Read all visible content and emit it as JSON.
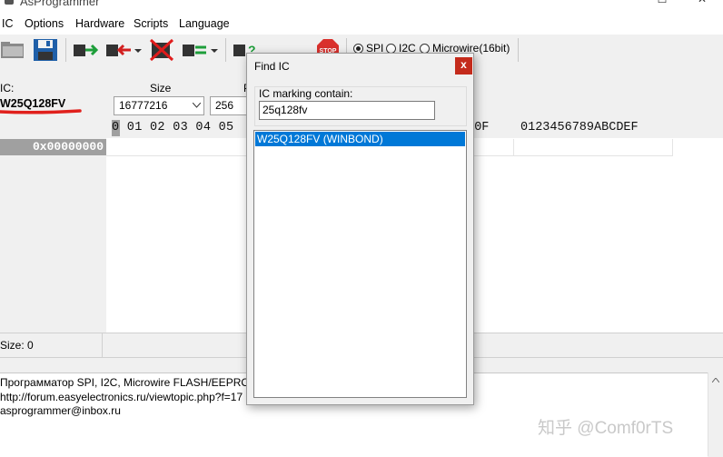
{
  "window": {
    "title": "AsProgrammer",
    "controls": [
      "─",
      "☐",
      "✕"
    ]
  },
  "menu": [
    "IC",
    "Options",
    "Hardware",
    "Scripts",
    "Language"
  ],
  "interfaces": {
    "selected": "SPI",
    "options": [
      "SPI",
      "I2C",
      "Microwire(16bit)"
    ]
  },
  "toolbar": {
    "stop_label": "STOP"
  },
  "ic_panel": {
    "label": "IC:",
    "ic_name": "W25Q128FV",
    "size_label": "Size",
    "size_value": "16777216",
    "page_label": "P",
    "page_value": "256"
  },
  "hex": {
    "header_cursor": "0",
    "header_left": "0 01 02 03 04 05",
    "header_right": "E 0F",
    "ascii_header": "0123456789ABCDEF",
    "first_address": "0x00000000"
  },
  "status": {
    "size_text": "Size: 0"
  },
  "log": {
    "lines": [
      "Программатор SPI, I2C, Microwire FLASH/EEPROM",
      "http://forum.easyelectronics.ru/viewtopic.php?f=17",
      "asprogrammer@inbox.ru"
    ]
  },
  "dialog": {
    "title": "Find IC",
    "close": "x",
    "group_label": "IC marking contain:",
    "search_value": "25q128fv",
    "results": [
      "W25Q128FV (WINBOND)"
    ]
  },
  "watermark": "知乎 @Comf0rTS",
  "colors": {
    "selection": "#0078d7",
    "close_button": "#c42b1c",
    "annotation_underline": "#e0201c",
    "address_cell": "#a0a0a0"
  }
}
